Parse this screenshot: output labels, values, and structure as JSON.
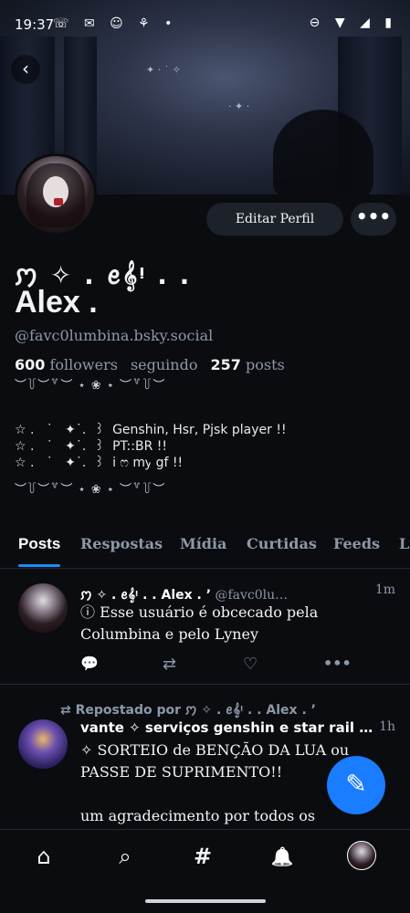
{
  "status_bar": {
    "time": "19:37",
    "left_icons": "☏ ✉ ☺ ⚘ •",
    "right_icons": "⊖ ▼ ◢ ▮"
  },
  "header": {
    "back_icon": "‹"
  },
  "profile": {
    "display_name_line1": "ꩀ ✧ . ꫀ𝄞ᵎ . .",
    "display_name_line2": "Alex .",
    "handle": "@favc0lumbina.bsky.social",
    "followers_count": "600",
    "followers_label": "followers",
    "following_label": "seguindo",
    "posts_count": "257",
    "posts_label": "posts",
    "edit_button": "Editar Perfil",
    "more_button": "•••",
    "bio_divider_top": "︶꒦︶꒷︶ ⋆ ❀ ⋆ ︶꒷꒦︶",
    "bio_line1": "☆ .   ˙   ✦˙.  ꒱  Genshin, Hsr, Pjsk player !!",
    "bio_line2": "☆ .   ˙   ✦˙.  ꒱  PT::BR !!",
    "bio_line3": "☆ .   ˙   ✦˙.  ꒱  i ෆ mꭚ gf !!",
    "bio_divider_bottom": "︶꒦︶꒷︶ ⋆ ❀ ⋆ ︶꒷꒦︶"
  },
  "tabs": [
    "Posts",
    "Respostas",
    "Mídia",
    "Curtidas",
    "Feeds",
    "Listas"
  ],
  "posts": [
    {
      "author": "ꩀ ✧ . ꫀ𝄞ᵎ . . Alex . ’",
      "handle": "@favc0lu…",
      "time": "1m",
      "text": "ⓘ Esse usuário é obcecado pela Columbina e pelo Lyney",
      "actions": {
        "reply_icon": "💬",
        "repost_icon": "⇄",
        "like_icon": "♡",
        "more_icon": "•••"
      }
    },
    {
      "repost_label": "⇄ Repostado por ꩀ ✧ . ꫀ𝄞ᵎ . . Alex . ’",
      "author": "vante ✧ serviços genshin e star rail …",
      "time": "1h",
      "text": "✧ SORTEIO de BENÇÃO DA LUA ou PASSE DE SUPRIMENTO!!\n\num agradecimento por todos os"
    }
  ],
  "fab_icon": "✎",
  "bottom_nav": {
    "home_icon": "⌂",
    "search_icon": "⌕",
    "feeds_icon": "#",
    "notifications_icon": "🔔"
  },
  "colors": {
    "accent": "#1a7cff",
    "background": "#0a0c10",
    "muted": "#8d98a8"
  }
}
